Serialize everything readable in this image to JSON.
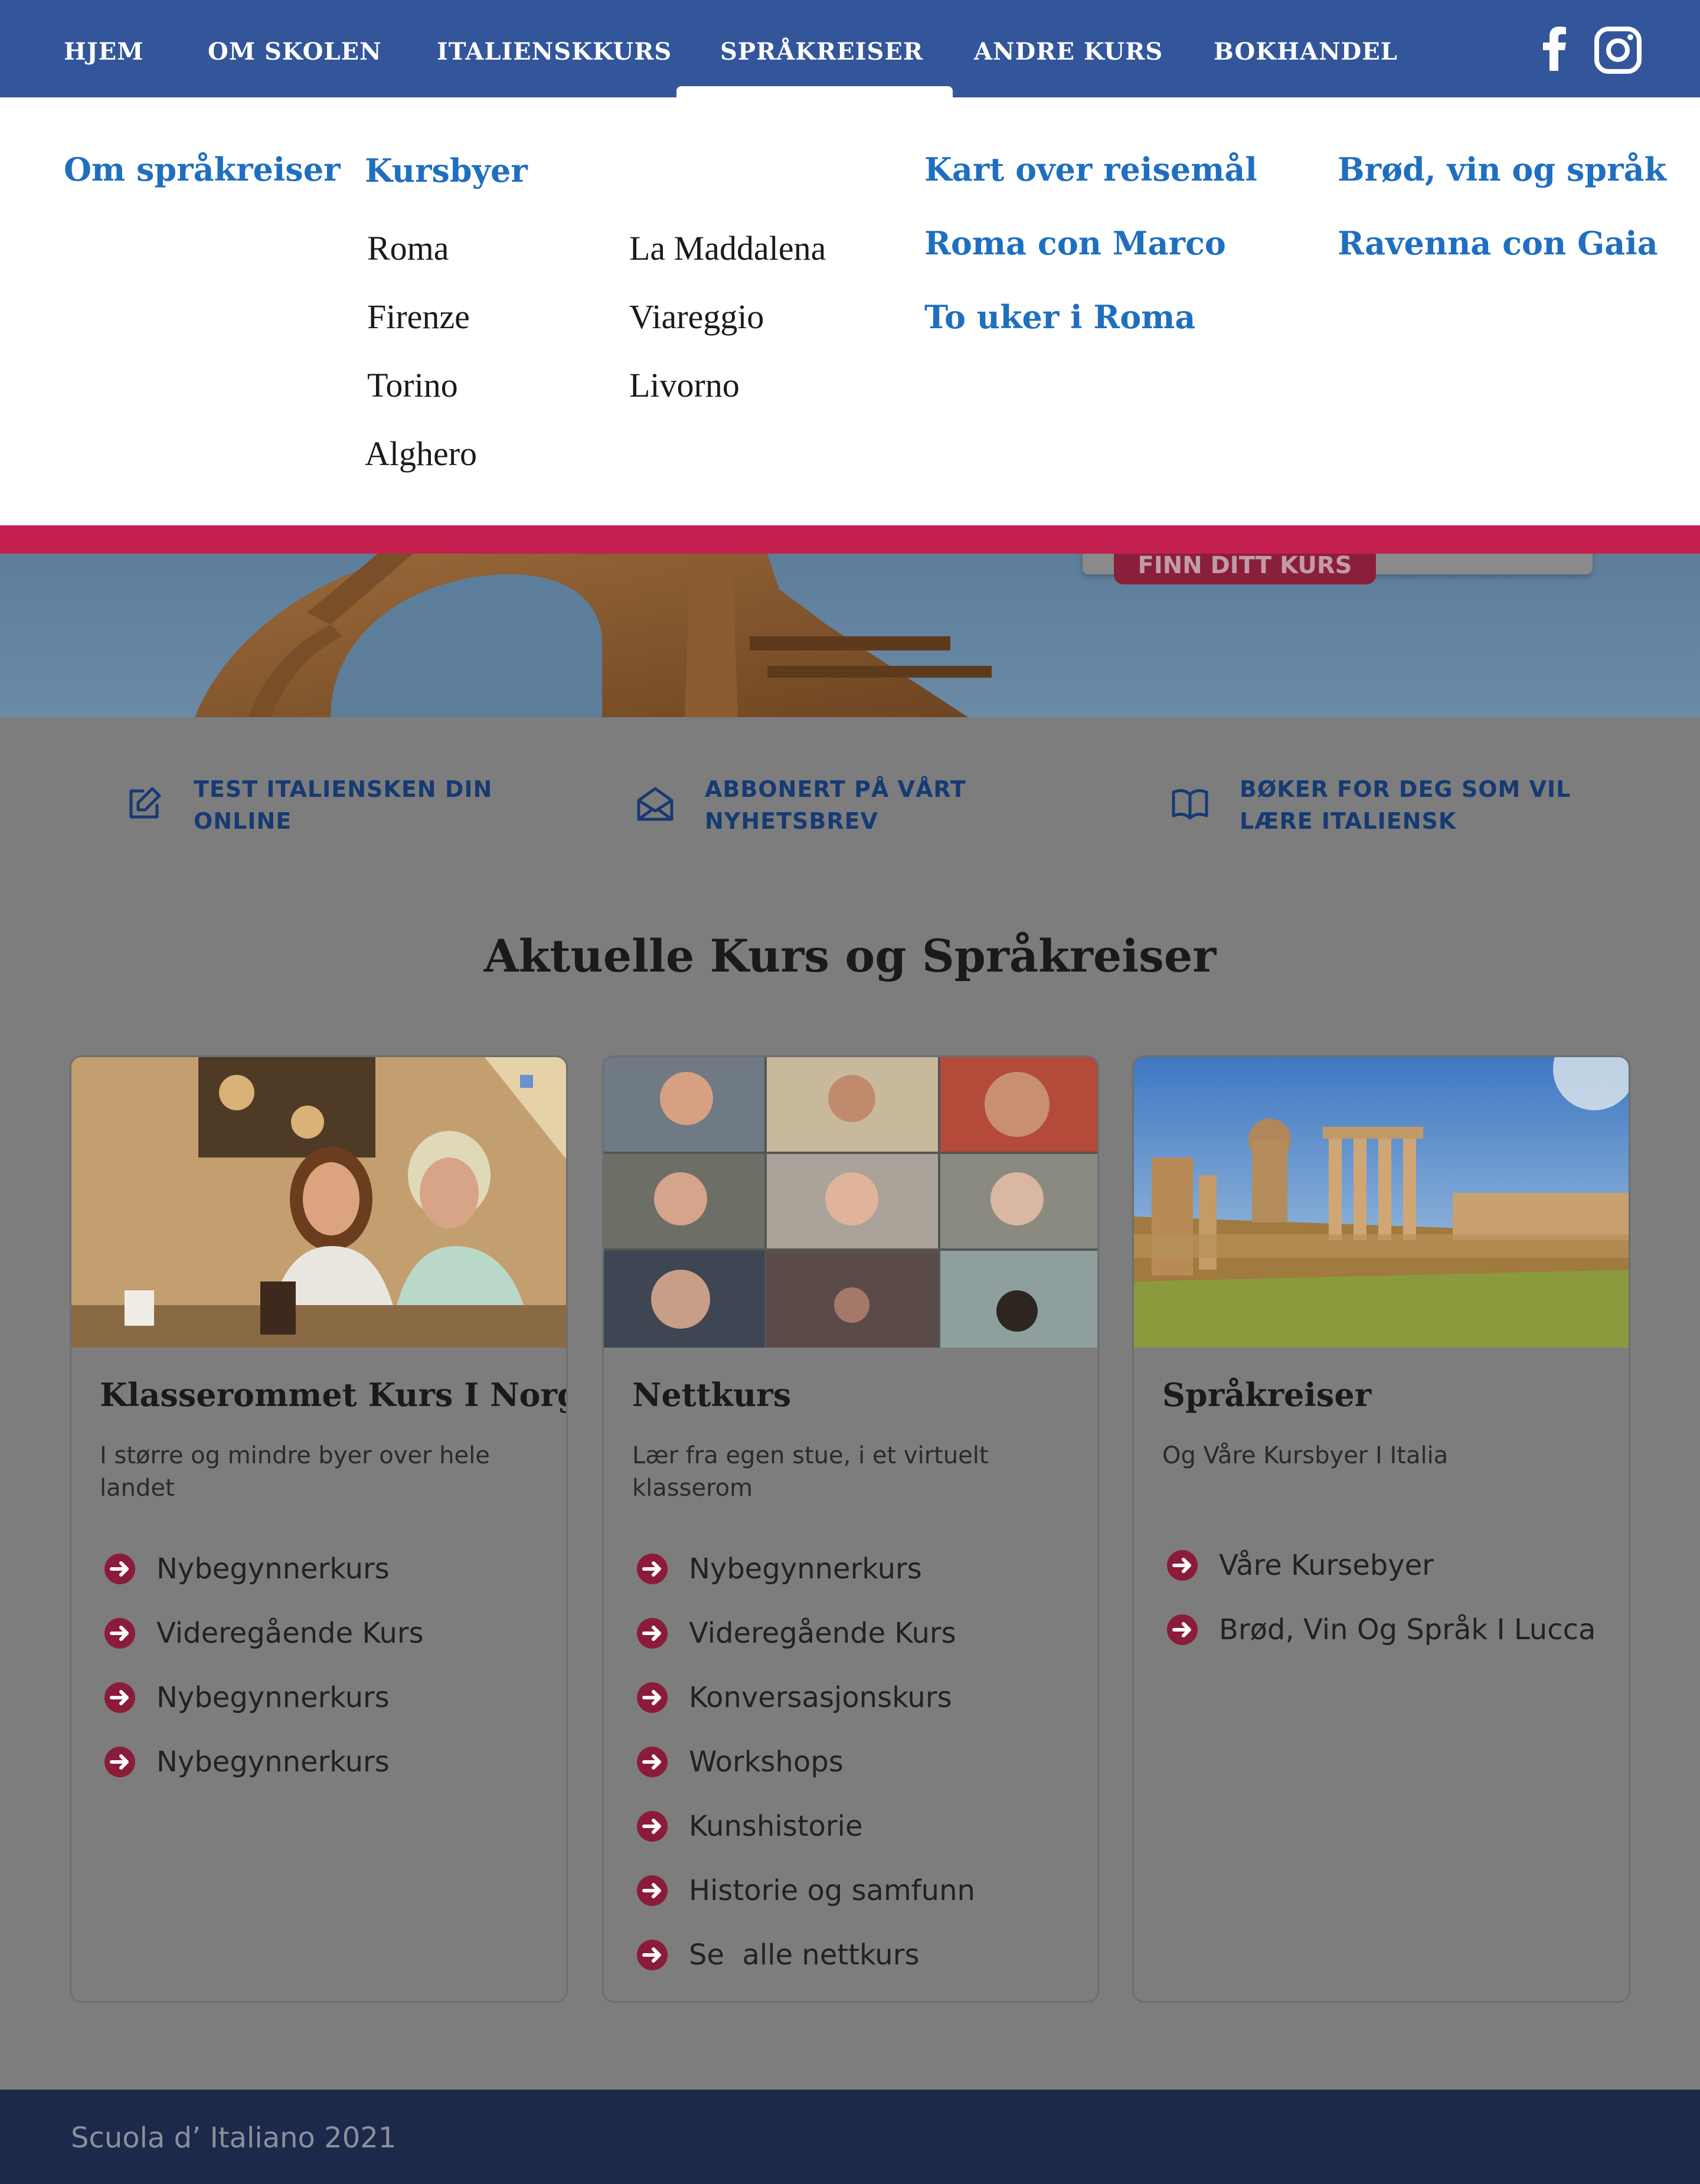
{
  "nav": {
    "items": [
      "HJEM",
      "OM SKOLEN",
      "ITALIENSKKURS",
      "SPRÅKREISER",
      "ANDRE KURS",
      "BOKHANDEL"
    ],
    "active": "SPRÅKREISER",
    "social": [
      "facebook-icon",
      "instagram-icon"
    ]
  },
  "mega_menu": {
    "about": "Om språkreiser",
    "cities_heading": "Kursbyer",
    "cities_col1": [
      "Roma",
      "Firenze",
      "Torino",
      "Alghero"
    ],
    "cities_col2": [
      "La Maddalena",
      "Viareggio",
      "Livorno"
    ],
    "col3": [
      "Kart over reisemål",
      "Roma con Marco",
      "To uker i Roma"
    ],
    "col4": [
      "Brød, vin og språk",
      "Ravenna con Gaia"
    ]
  },
  "hero": {
    "button": "FINN DITT KURS"
  },
  "quick_links": [
    {
      "icon": "edit-icon",
      "line1": "TEST ITALIENSKEN DIN",
      "line2": "ONLINE"
    },
    {
      "icon": "envelope-icon",
      "line1": "ABBONERT PÅ VÅRT",
      "line2": "NYHETSBREV"
    },
    {
      "icon": "book-icon",
      "line1": "BØKER FOR DEG SOM VIL",
      "line2": "LÆRE ITALIENSK"
    }
  ],
  "section_title": "Aktuelle Kurs og Språkreiser",
  "cards": [
    {
      "title": "Klasserommet Kurs I Norge",
      "subtitle": "I større og mindre byer over hele landet",
      "links": [
        "Nybegynnerkurs",
        "Videregående Kurs",
        "Nybegynnerkurs",
        "Nybegynnerkurs"
      ]
    },
    {
      "title": "Nettkurs",
      "subtitle": "Lær fra egen stue, i et virtuelt klasserom",
      "links": [
        "Nybegynnerkurs",
        "Videregående Kurs",
        "Konversasjonskurs",
        "Workshops",
        "Kunshistorie",
        "Historie og samfunn",
        "Se  alle nettkurs"
      ]
    },
    {
      "title": "Språkreiser",
      "subtitle": "Og Våre Kursbyer I Italia",
      "links": [
        "Våre Kursebyer",
        "Brød, Vin Og Språk I Lucca"
      ]
    }
  ],
  "footer": {
    "copyright": "Scuola d’ Italiano 2021"
  },
  "colors": {
    "nav_bg": "#33569a",
    "accent_red": "#c4204f",
    "link_blue": "#1f6fc0",
    "footer_bg": "#1c294b"
  }
}
